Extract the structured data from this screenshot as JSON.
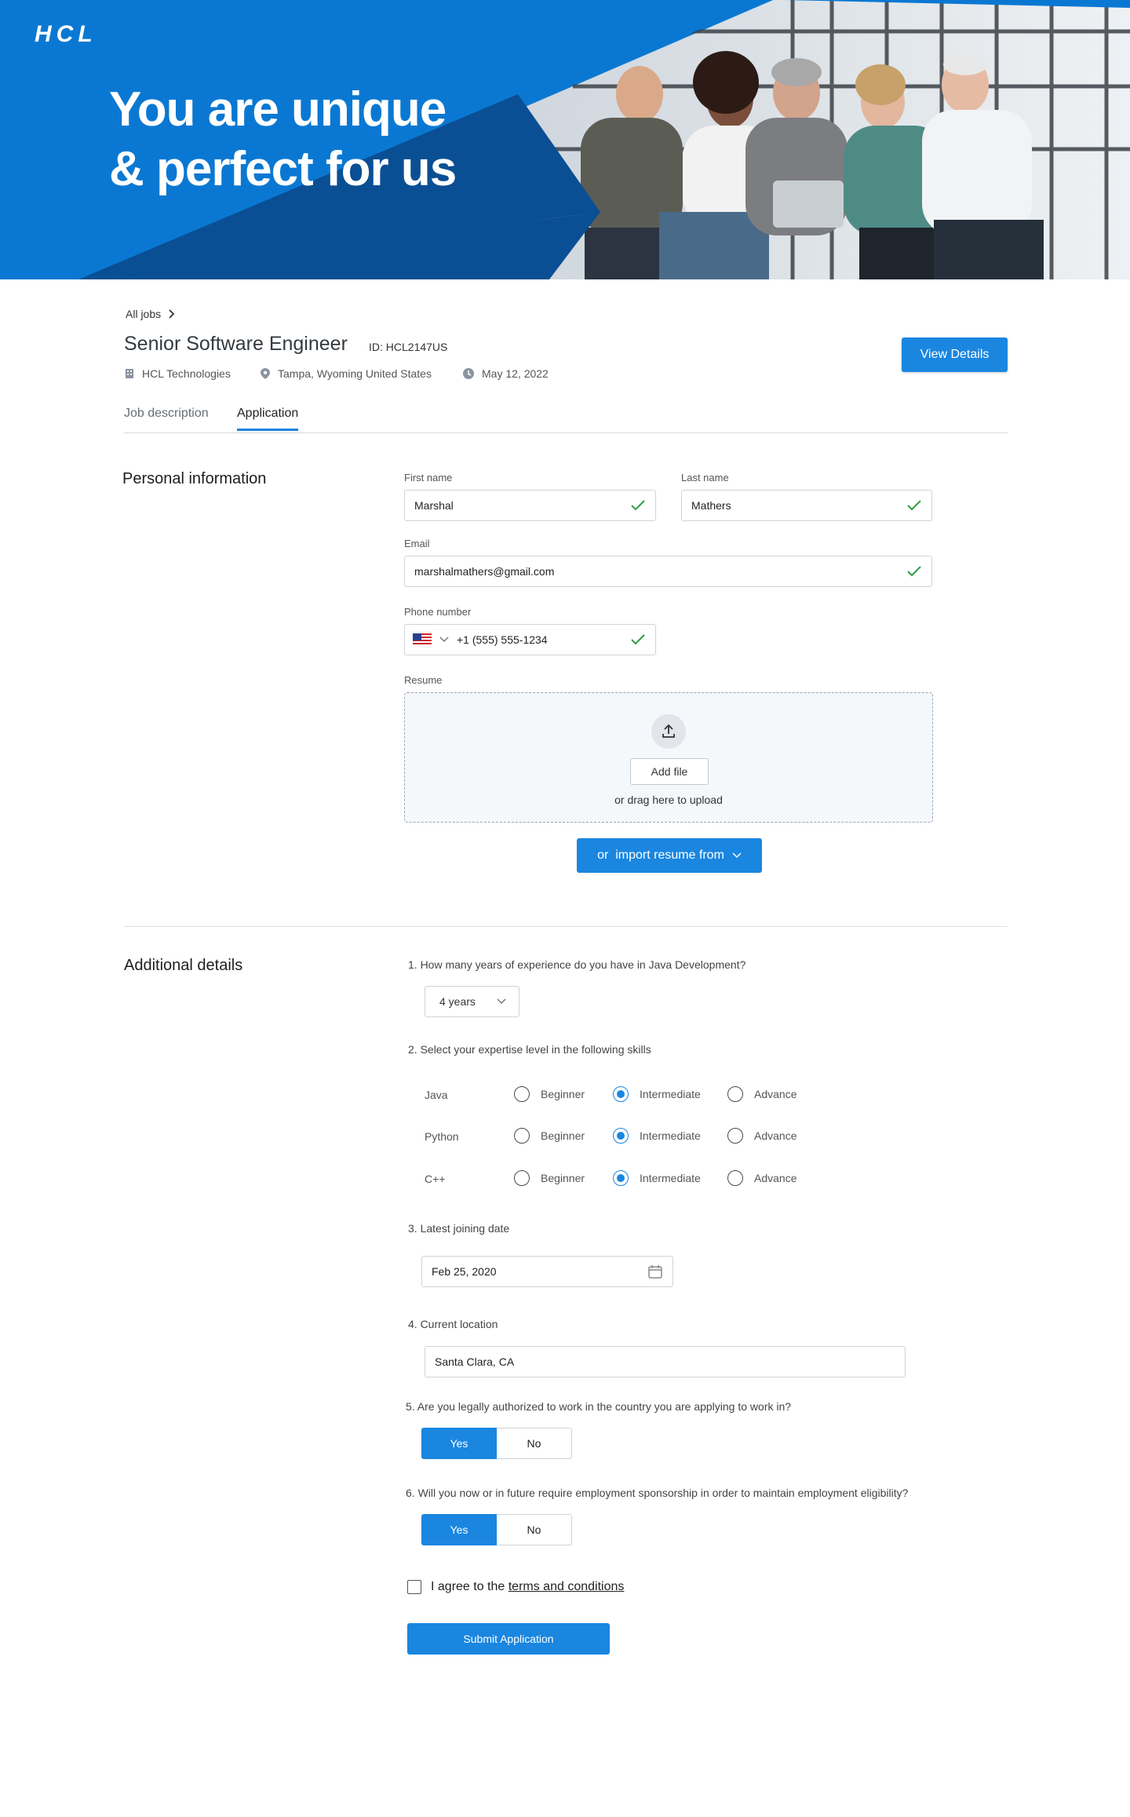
{
  "brand": {
    "logo_text": "HCL",
    "accent": "#1a86e0",
    "hero_blue": "#0a78d2",
    "hero_dark": "#0a4f94"
  },
  "hero": {
    "line1": "You are unique",
    "line2": "& perfect for us"
  },
  "breadcrumb": {
    "label": "All jobs"
  },
  "job": {
    "title": "Senior Software Engineer",
    "id": "ID: HCL2147US",
    "company": "HCL Technologies",
    "location": "Tampa, Wyoming United States",
    "date": "May 12, 2022",
    "view_details_label": "View Details"
  },
  "tabs": [
    {
      "label": "Job description",
      "active": false
    },
    {
      "label": "Application",
      "active": true
    }
  ],
  "personal": {
    "title": "Personal information",
    "first_name": {
      "label": "First name",
      "value": "Marshal"
    },
    "last_name": {
      "label": "Last name",
      "value": "Mathers"
    },
    "email": {
      "label": "Email",
      "value": "marshalmathers@gmail.com"
    },
    "phone": {
      "label": "Phone number",
      "value": "+1 (555) 555-1234",
      "country_icon": "us-flag-icon"
    },
    "resume": {
      "label": "Resume",
      "add_file_label": "Add file",
      "drag_text": "or drag here to upload",
      "import_label": "or  import resume from"
    }
  },
  "additional": {
    "title": "Additional details",
    "q1": {
      "text": "1. How many years of experience do you have in Java Development?",
      "selected": "4 years"
    },
    "q2": {
      "text": "2. Select your expertise level in the following skills",
      "levels": [
        "Beginner",
        "Intermediate",
        "Advance"
      ],
      "skills": [
        {
          "name": "Java",
          "selected": "Intermediate"
        },
        {
          "name": "Python",
          "selected": "Intermediate"
        },
        {
          "name": "C++",
          "selected": "Intermediate"
        }
      ]
    },
    "q3": {
      "text": "3. Latest joining date",
      "value": "Feb 25, 2020"
    },
    "q4": {
      "text": "4. Current location",
      "value": "Santa Clara, CA"
    },
    "q5": {
      "text": "5. Are you legally authorized to work in the country you are applying to work in?",
      "yes": "Yes",
      "no": "No",
      "selected": "Yes"
    },
    "q6": {
      "text": "6. Will you now or in future require employment sponsorship in order to maintain employment eligibility?",
      "yes": "Yes",
      "no": "No",
      "selected": "Yes"
    },
    "agree_prefix": "I agree to the ",
    "agree_link": "terms and conditions",
    "submit_label": "Submit Application"
  }
}
